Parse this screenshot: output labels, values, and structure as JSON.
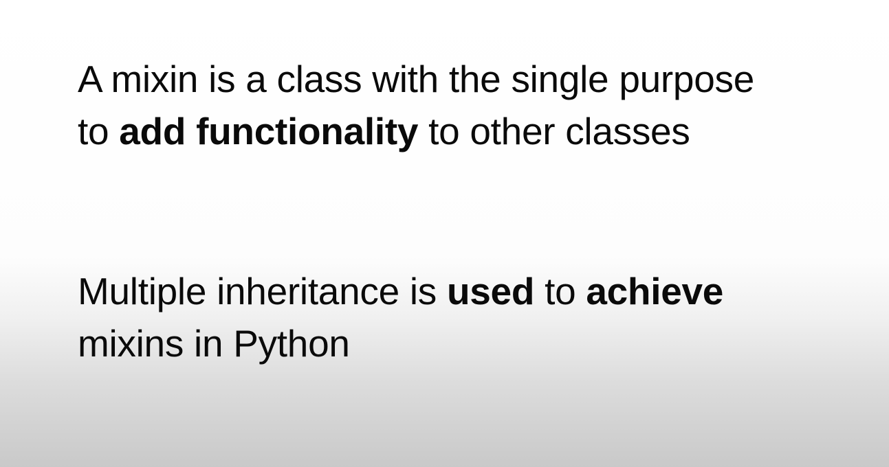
{
  "slide": {
    "statement_1": {
      "line_1": "A mixin is a class with the single purpose",
      "line_2_prefix": "to ",
      "line_2_bold": "add functionality",
      "line_2_suffix": " to other classes"
    },
    "statement_2": {
      "line_1_prefix": "Multiple inheritance is ",
      "line_1_bold_1": "used",
      "line_1_middle": " to ",
      "line_1_bold_2": "achieve",
      "line_2": "mixins in Python"
    }
  }
}
